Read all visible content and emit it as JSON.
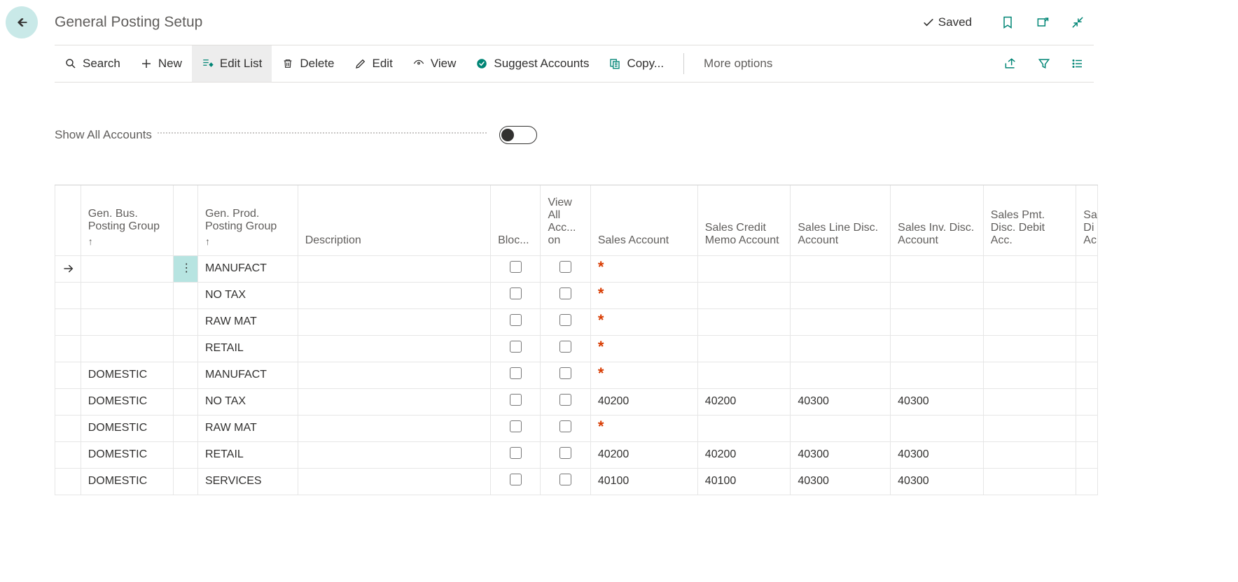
{
  "header": {
    "title": "General Posting Setup",
    "saved_label": "Saved"
  },
  "toolbar": {
    "search": "Search",
    "new": "New",
    "edit_list": "Edit List",
    "delete": "Delete",
    "edit": "Edit",
    "view": "View",
    "suggest": "Suggest Accounts",
    "copy": "Copy...",
    "more": "More options"
  },
  "options": {
    "show_all_accounts_label": "Show All Accounts"
  },
  "columns": {
    "gbpg": "Gen. Bus. Posting Group",
    "gppg": "Gen. Prod. Posting Group",
    "desc": "Description",
    "bloc": "Bloc...",
    "view": "View All Acc... on",
    "sales": "Sales Account",
    "credit": "Sales Credit Memo Account",
    "line": "Sales Line Disc. Account",
    "inv": "Sales Inv. Disc. Account",
    "pmt": "Sales Pmt. Disc. Debit Acc.",
    "last1": "Sa",
    "last2": "Di",
    "last3": "Ac"
  },
  "rows": [
    {
      "selected": true,
      "gbpg": "",
      "gppg": "MANUFACT",
      "sales": "*",
      "credit": "",
      "line": "",
      "inv": "",
      "pmt": ""
    },
    {
      "selected": false,
      "gbpg": "",
      "gppg": "NO TAX",
      "sales": "*",
      "credit": "",
      "line": "",
      "inv": "",
      "pmt": ""
    },
    {
      "selected": false,
      "gbpg": "",
      "gppg": "RAW MAT",
      "sales": "*",
      "credit": "",
      "line": "",
      "inv": "",
      "pmt": ""
    },
    {
      "selected": false,
      "gbpg": "",
      "gppg": "RETAIL",
      "sales": "*",
      "credit": "",
      "line": "",
      "inv": "",
      "pmt": ""
    },
    {
      "selected": false,
      "gbpg": "DOMESTIC",
      "gppg": "MANUFACT",
      "sales": "*",
      "credit": "",
      "line": "",
      "inv": "",
      "pmt": ""
    },
    {
      "selected": false,
      "gbpg": "DOMESTIC",
      "gppg": "NO TAX",
      "sales": "40200",
      "credit": "40200",
      "line": "40300",
      "inv": "40300",
      "pmt": ""
    },
    {
      "selected": false,
      "gbpg": "DOMESTIC",
      "gppg": "RAW MAT",
      "sales": "*",
      "credit": "",
      "line": "",
      "inv": "",
      "pmt": ""
    },
    {
      "selected": false,
      "gbpg": "DOMESTIC",
      "gppg": "RETAIL",
      "sales": "40200",
      "credit": "40200",
      "line": "40300",
      "inv": "40300",
      "pmt": ""
    },
    {
      "selected": false,
      "gbpg": "DOMESTIC",
      "gppg": "SERVICES",
      "sales": "40100",
      "credit": "40100",
      "line": "40300",
      "inv": "40300",
      "pmt": ""
    }
  ]
}
